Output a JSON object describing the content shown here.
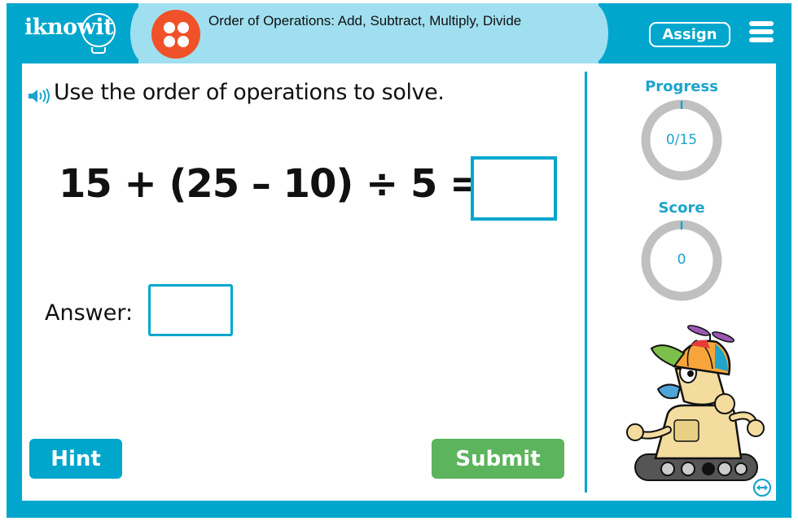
{
  "header": {
    "logo_text": "iknowit",
    "topic_icon": "four-dots-icon",
    "topic_title": "Order of Operations: Add, Subtract, Multiply, Divide",
    "assign_label": "Assign",
    "menu_icon": "hamburger-menu-icon"
  },
  "question": {
    "speaker_icon": "speaker-icon",
    "instruction": "Use the order of operations to solve.",
    "expression": "15 + (25 – 10) ÷ 5 =",
    "answer_label": "Answer:",
    "answer_value": "",
    "answer_placeholder": ""
  },
  "buttons": {
    "hint": "Hint",
    "submit": "Submit"
  },
  "stats": {
    "progress_label": "Progress",
    "progress_value": "0/15",
    "progress_fraction": 0,
    "score_label": "Score",
    "score_value": "0",
    "score_fraction": 0
  },
  "colors": {
    "brand_blue": "#01a6cd",
    "pill_blue": "#a0dfef",
    "topic_orange": "#f05128",
    "submit_green": "#5cb45c",
    "ring_gray": "#c0c0c0"
  },
  "mascot": {
    "icon": "robot-mascot-icon"
  },
  "resize_icon": "resize-arrows-icon"
}
